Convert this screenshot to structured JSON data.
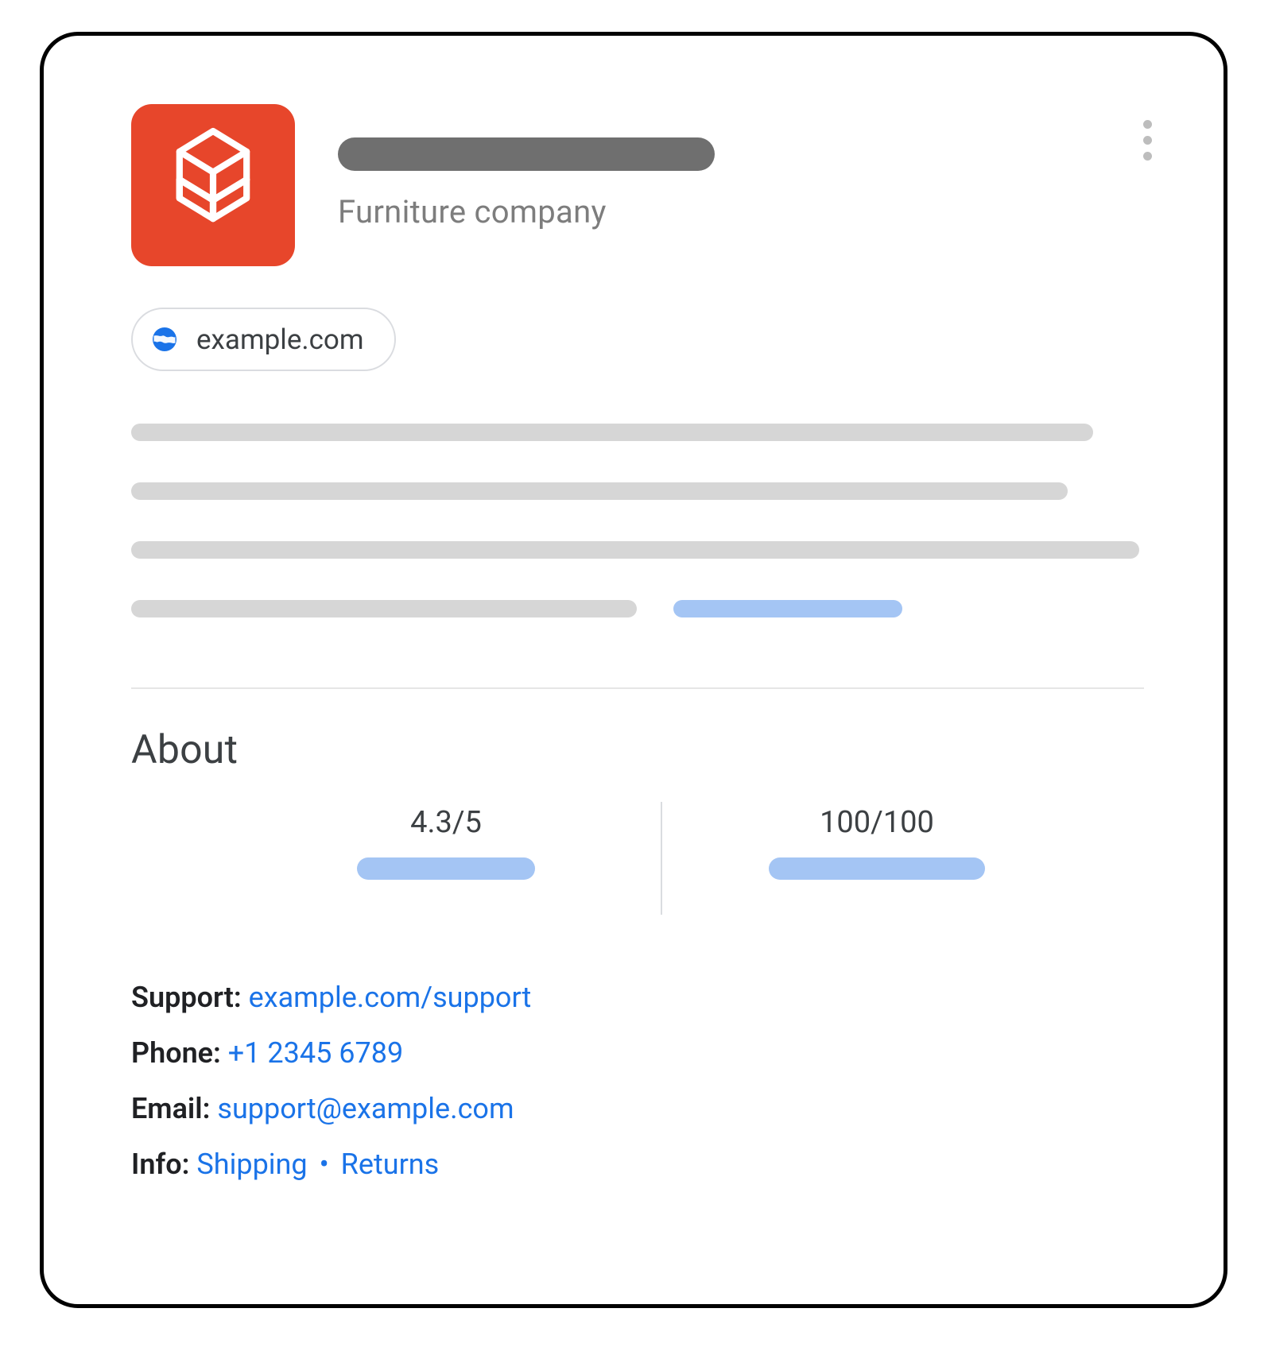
{
  "header": {
    "subtitle": "Furniture company",
    "website": "example.com"
  },
  "about": {
    "title": "About",
    "rating": "4.3/5",
    "score": "100/100"
  },
  "contact": {
    "support_label": "Support:",
    "support_link": "example.com/support",
    "phone_label": "Phone:",
    "phone_link": "+1 2345 6789",
    "email_label": "Email:",
    "email_link": "support@example.com",
    "info_label": "Info:",
    "info_shipping": "Shipping",
    "info_separator": "•",
    "info_returns": "Returns"
  }
}
